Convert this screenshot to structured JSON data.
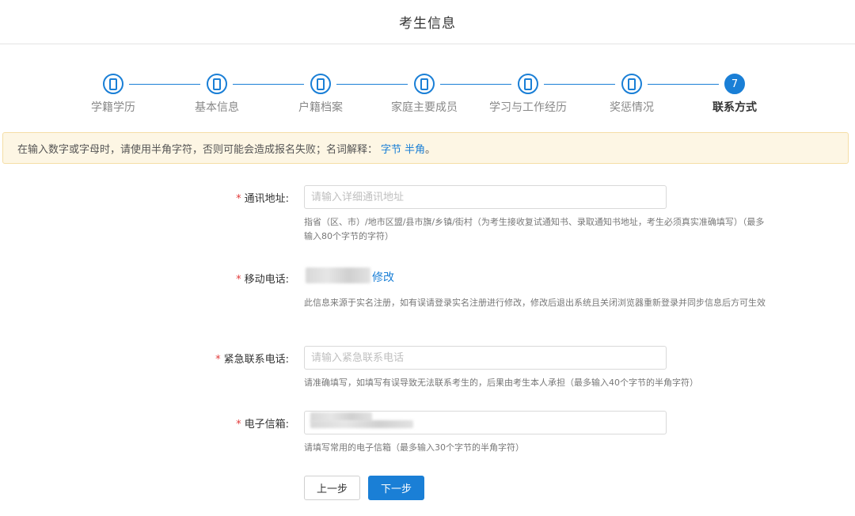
{
  "header": {
    "title": "考生信息"
  },
  "steps": [
    {
      "label": "学籍学历",
      "state": "done"
    },
    {
      "label": "基本信息",
      "state": "done"
    },
    {
      "label": "户籍档案",
      "state": "done"
    },
    {
      "label": "家庭主要成员",
      "state": "done"
    },
    {
      "label": "学习与工作经历",
      "state": "done"
    },
    {
      "label": "奖惩情况",
      "state": "done"
    },
    {
      "label": "联系方式",
      "state": "active",
      "number": "7"
    }
  ],
  "notice": {
    "text": "在输入数字或字母时，请使用半角字符，否则可能会造成报名失败；名词解释：",
    "link1": "字节",
    "link2": "半角",
    "tail": "。"
  },
  "form": {
    "required_mark": "*",
    "address": {
      "label": "通讯地址:",
      "placeholder": "请输入详细通讯地址",
      "hint": "指省（区、市）/地市区盟/县市旗/乡镇/街村（为考生接收复试通知书、录取通知书地址，考生必须真实准确填写）（最多输入80个字节的字符）"
    },
    "mobile": {
      "label": "移动电话:",
      "edit_label": "修改",
      "hint": "此信息来源于实名注册，如有误请登录实名注册进行修改，修改后退出系统且关闭浏览器重新登录并同步信息后方可生效"
    },
    "emergency": {
      "label": "紧急联系电话:",
      "placeholder": "请输入紧急联系电话",
      "hint": "请准确填写，如填写有误导致无法联系考生的，后果由考生本人承担（最多输入40个字节的半角字符）"
    },
    "email": {
      "label": "电子信箱:",
      "hint": "请填写常用的电子信箱（最多输入30个字节的半角字符）"
    }
  },
  "buttons": {
    "prev": "上一步",
    "next": "下一步"
  },
  "colors": {
    "accent": "#1a7fd6",
    "required": "#e23b3b",
    "notice_bg": "#fdf6e4"
  }
}
